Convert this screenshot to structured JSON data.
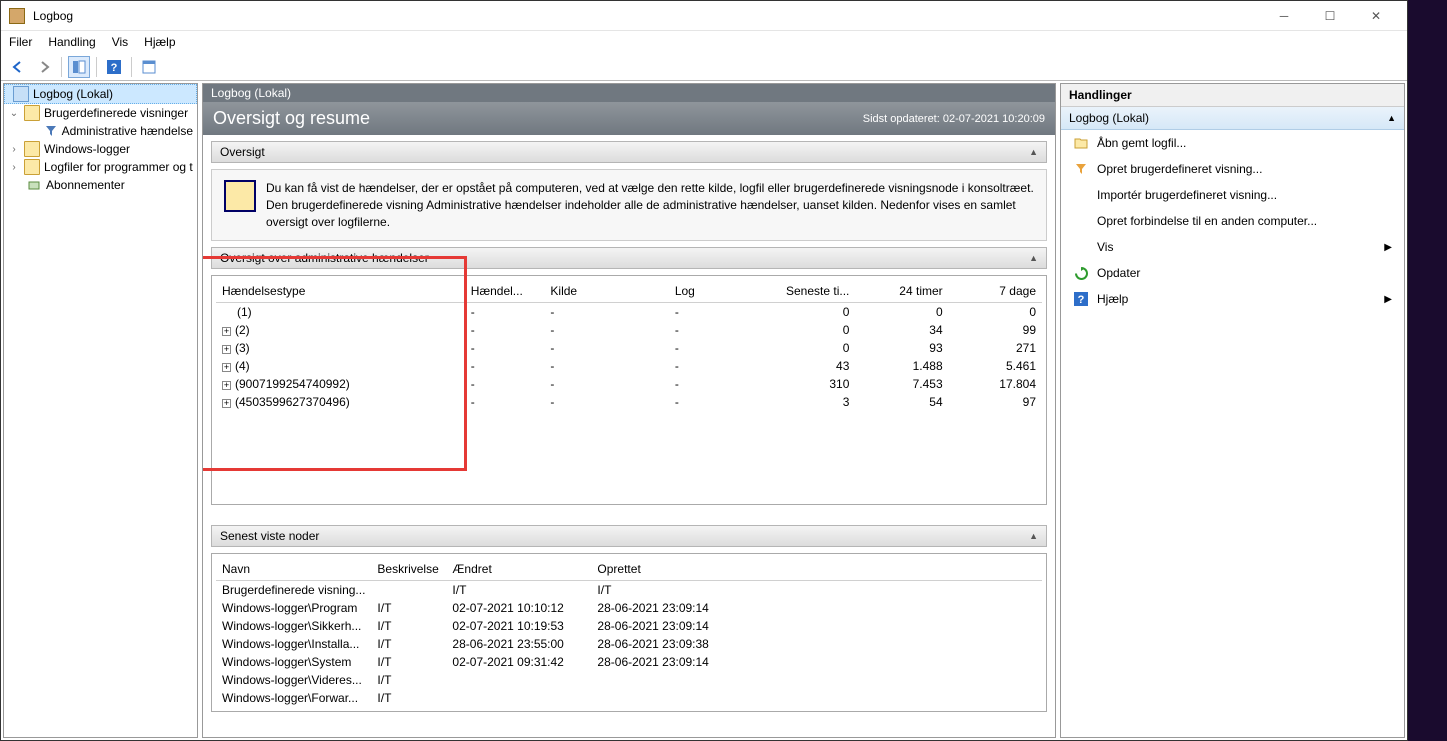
{
  "window": {
    "title": "Logbog"
  },
  "menu": {
    "file": "Filer",
    "action": "Handling",
    "view": "Vis",
    "help": "Hjælp"
  },
  "tree": {
    "root": "Logbog (Lokal)",
    "custom_views": "Brugerdefinerede visninger",
    "admin_events": "Administrative hændelse",
    "windows_logs": "Windows-logger",
    "app_logs": "Logfiler for programmer og t",
    "subscriptions": "Abonnementer"
  },
  "main": {
    "header": "Logbog (Lokal)",
    "summary_title": "Oversigt og resume",
    "last_updated": "Sidst opdateret: 02-07-2021 10:20:09",
    "section_overview": "Oversigt",
    "overview_text": "Du kan få vist de hændelser, der er opstået på computeren, ved at vælge den rette kilde, logfil eller brugerdefinerede visningsnode i konsoltræet. Den brugerdefinerede visning Administrative hændelser indeholder alle de administrative hændelser, uanset kilden. Nedenfor vises en samlet oversigt over logfilerne.",
    "section_admin": "Oversigt over administrative hændelser",
    "event_cols": {
      "type": "Hændelsestype",
      "id": "Hændel...",
      "source": "Kilde",
      "log": "Log",
      "latest": "Seneste ti...",
      "h24": "24 timer",
      "d7": "7 dage"
    },
    "events": [
      {
        "label": "(1)",
        "exp": false,
        "id": "-",
        "source": "-",
        "log": "-",
        "latest": "0",
        "h24": "0",
        "d7": "0"
      },
      {
        "label": "(2)",
        "exp": true,
        "id": "-",
        "source": "-",
        "log": "-",
        "latest": "0",
        "h24": "34",
        "d7": "99"
      },
      {
        "label": "(3)",
        "exp": true,
        "id": "-",
        "source": "-",
        "log": "-",
        "latest": "0",
        "h24": "93",
        "d7": "271"
      },
      {
        "label": "(4)",
        "exp": true,
        "id": "-",
        "source": "-",
        "log": "-",
        "latest": "43",
        "h24": "1.488",
        "d7": "5.461"
      },
      {
        "label": "(9007199254740992)",
        "exp": true,
        "id": "-",
        "source": "-",
        "log": "-",
        "latest": "310",
        "h24": "7.453",
        "d7": "17.804"
      },
      {
        "label": "(4503599627370496)",
        "exp": true,
        "id": "-",
        "source": "-",
        "log": "-",
        "latest": "3",
        "h24": "54",
        "d7": "97"
      }
    ],
    "section_nodes": "Senest viste noder",
    "node_cols": {
      "name": "Navn",
      "desc": "Beskrivelse",
      "modified": "Ændret",
      "created": "Oprettet"
    },
    "nodes": [
      {
        "name": "Brugerdefinerede visning...",
        "desc": "",
        "mod": "I/T",
        "cre": "I/T"
      },
      {
        "name": "Windows-logger\\Program",
        "desc": "I/T",
        "mod": "02-07-2021 10:10:12",
        "cre": "28-06-2021 23:09:14"
      },
      {
        "name": "Windows-logger\\Sikkerh...",
        "desc": "I/T",
        "mod": "02-07-2021 10:19:53",
        "cre": "28-06-2021 23:09:14"
      },
      {
        "name": "Windows-logger\\Installa...",
        "desc": "I/T",
        "mod": "28-06-2021 23:55:00",
        "cre": "28-06-2021 23:09:38"
      },
      {
        "name": "Windows-logger\\System",
        "desc": "I/T",
        "mod": "02-07-2021 09:31:42",
        "cre": "28-06-2021 23:09:14"
      },
      {
        "name": "Windows-logger\\Videres...",
        "desc": "I/T",
        "mod": "",
        "cre": ""
      },
      {
        "name": "Windows-logger\\Forwar...",
        "desc": "I/T",
        "mod": "",
        "cre": ""
      }
    ]
  },
  "actions": {
    "header": "Handlinger",
    "sub": "Logbog (Lokal)",
    "open_saved": "Åbn gemt logfil...",
    "create_custom": "Opret brugerdefineret visning...",
    "import_custom": "Importér brugerdefineret visning...",
    "connect": "Opret forbindelse til en anden computer...",
    "view": "Vis",
    "refresh": "Opdater",
    "help": "Hjælp"
  }
}
